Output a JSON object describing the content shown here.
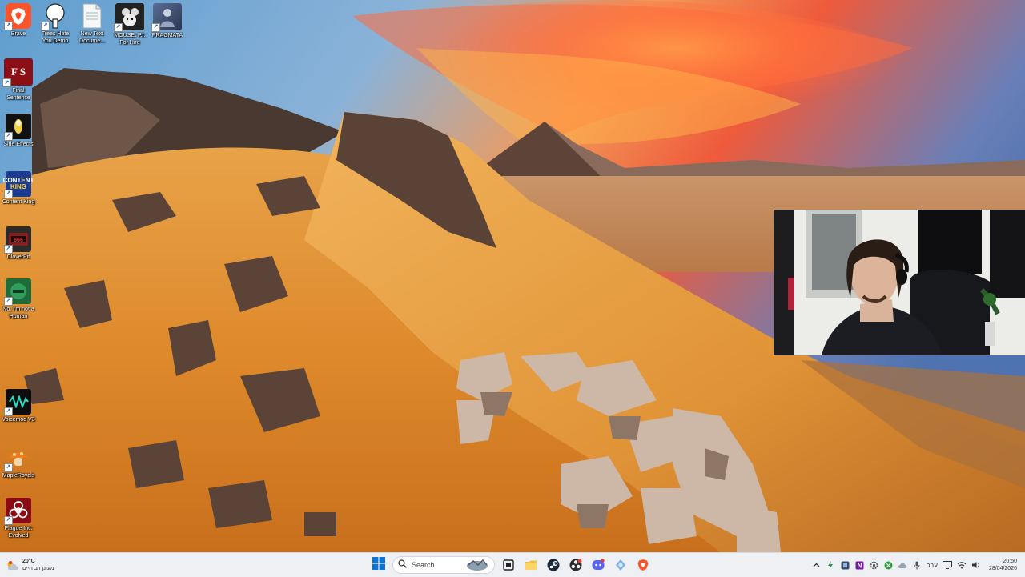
{
  "desktop": {
    "icons": [
      {
        "id": "brave",
        "label": "Brave",
        "icon": "brave-lion-icon",
        "color": "#fb542b"
      },
      {
        "id": "trees-hate-you",
        "label": "Trees Hate You Demo",
        "icon": "tree-icon",
        "color": "#ffffff"
      },
      {
        "id": "new-text-doc",
        "label": "New Text Docume...",
        "icon": "text-document-icon",
        "color": "#f5f5f5"
      },
      {
        "id": "mouse-pi",
        "label": "MOUSE: P.I. For Hire",
        "icon": "mouse-game-icon",
        "color": "#222222"
      },
      {
        "id": "pragmata",
        "label": "PRAGMATA",
        "icon": "pragmata-game-icon",
        "color": "#3d4a6b"
      },
      {
        "id": "final-sentence",
        "label": "Final Sentence",
        "icon": "final-sentence-icon",
        "color": "#8b0f14"
      },
      {
        "id": "side-effects",
        "label": "Side Effects",
        "icon": "side-effects-icon",
        "color": "#1b1b1b"
      },
      {
        "id": "content-king",
        "label": "Content King",
        "icon": "content-king-icon",
        "color": "#1c3d8f"
      },
      {
        "id": "cloverpit",
        "label": "CloverPit",
        "icon": "cloverpit-icon",
        "color": "#2b2b2b"
      },
      {
        "id": "no-im-not-human",
        "label": "No, I'm not a Human",
        "icon": "not-human-icon",
        "color": "#1f6b3a"
      },
      {
        "id": "voicemod",
        "label": "Voicemod V3",
        "icon": "voicemod-icon",
        "color": "#0d0d0d"
      },
      {
        "id": "maple-royals",
        "label": "MapleRoyals",
        "icon": "maple-mushroom-icon",
        "color": "#e86a1e"
      },
      {
        "id": "plague-inc",
        "label": "Plague Inc: Evolved",
        "icon": "biohazard-icon",
        "color": "#8a0c12"
      }
    ]
  },
  "taskbar": {
    "weather": {
      "temp": "20°C",
      "condition": "מעונן רב חיים",
      "icon": "partly-cloudy-icon"
    },
    "start_icon": "windows-start-icon",
    "search": {
      "placeholder": "Search",
      "icon": "search-icon"
    },
    "apps": [
      {
        "name": "task-view-icon"
      },
      {
        "name": "file-explorer-icon"
      },
      {
        "name": "steam-icon"
      },
      {
        "name": "obs-icon"
      },
      {
        "name": "discord-icon"
      },
      {
        "name": "voicemod-taskbar-icon"
      },
      {
        "name": "brave-taskbar-icon"
      }
    ],
    "tray": {
      "language": "עבר",
      "time": "20:50",
      "date": "28/04/2026"
    }
  }
}
